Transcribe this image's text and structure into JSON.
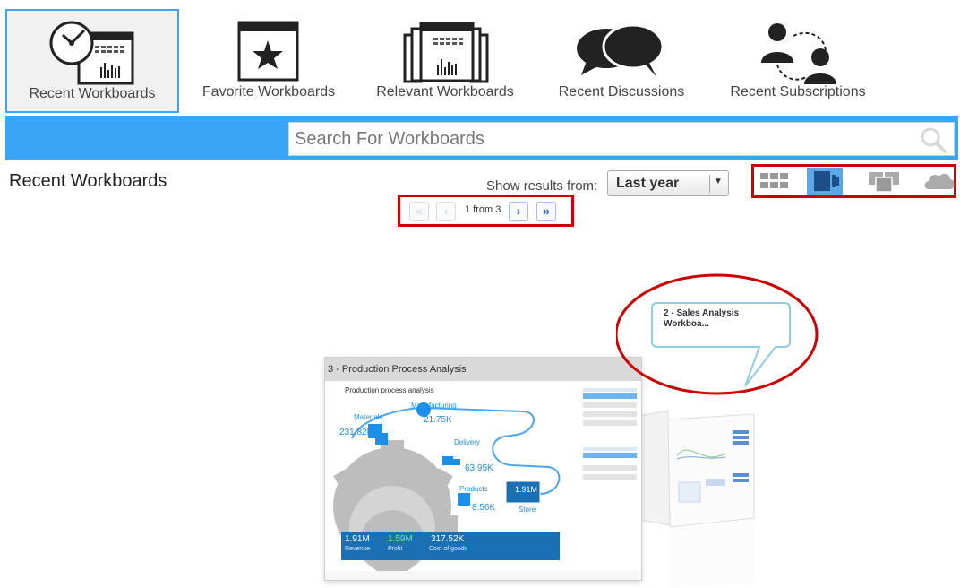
{
  "nav": {
    "tiles": [
      {
        "label": "Recent Workboards",
        "icon": "recent-workboards-icon",
        "active": true
      },
      {
        "label": "Favorite Workboards",
        "icon": "favorite-workboards-icon"
      },
      {
        "label": "Relevant Workboards",
        "icon": "relevant-workboards-icon"
      },
      {
        "label": "Recent Discussions",
        "icon": "discussions-icon"
      },
      {
        "label": "Recent Subscriptions",
        "icon": "subscriptions-icon"
      }
    ]
  },
  "search": {
    "placeholder": "Search For Workboards",
    "value": ""
  },
  "results": {
    "title": "Recent Workboards",
    "show_label": "Show results from:",
    "range_value": "Last year"
  },
  "pager": {
    "first": "«",
    "prev": "‹",
    "info": "1 from 3",
    "next": "›",
    "last": "»"
  },
  "views": [
    "grid-view-icon",
    "cover-flow-view-icon",
    "stack-view-icon",
    "cloud-view-icon"
  ],
  "carousel": {
    "main_card_title": "3 - Production Process Analysis",
    "tooltip_text": "2 - Sales Analysis Workboa...",
    "dashboard": {
      "title": "Production process analysis",
      "materials_label": "Materials",
      "materials_value": "231.82K",
      "manufacturing_label": "Manufacturing",
      "manufacturing_value": "21.75K",
      "delivery_label": "Delivery",
      "delivery_value": "63.95K",
      "products_label": "Products",
      "products_value": "8.56K",
      "store_value": "1.91M",
      "store_label": "Store",
      "revenue_value": "1.91M",
      "revenue_label": "Revenue",
      "profit_value": "1.59M",
      "profit_label": "Profit",
      "cost_value": "317.52K",
      "cost_label": "Cost of goods"
    }
  },
  "colors": {
    "accent": "#3aa5f5",
    "highlight": "#cc0000",
    "dash_blue": "#1e8fe8",
    "dash_dark": "#1b6fb3"
  }
}
